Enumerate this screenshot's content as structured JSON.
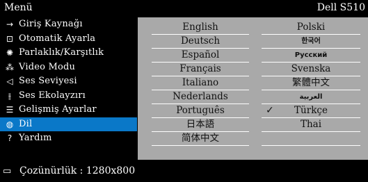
{
  "title": {
    "menu": "Menü",
    "model": "Dell S510"
  },
  "sidebar": {
    "items": [
      {
        "label": "Giriş Kaynağı",
        "icon": "→"
      },
      {
        "label": "Otomatik Ayarla",
        "icon": "⊡"
      },
      {
        "label": "Parlaklık/Karşıtlık",
        "icon": "✺"
      },
      {
        "label": "Video Modu",
        "icon": "⁂"
      },
      {
        "label": "Ses Seviyesi",
        "icon": "◁"
      },
      {
        "label": "Ses Ekolayzırı",
        "icon": "⫲"
      },
      {
        "label": "Gelişmiş Ayarlar",
        "icon": "☰"
      },
      {
        "label": "Dil",
        "icon": "◍"
      },
      {
        "label": "Yardım",
        "icon": "?"
      }
    ],
    "selected_index": 7
  },
  "languages": {
    "col1": [
      "English",
      "Deutsch",
      "Español",
      "Français",
      "Italiano",
      "Nederlands",
      "Português",
      "日本語",
      "简体中文"
    ],
    "col2": [
      "Polski",
      "한국어",
      "Русский",
      "Svenska",
      "繁體中文",
      "العربية",
      "Türkçe",
      "Thai",
      ""
    ],
    "selected": "Türkçe",
    "check_mark": "✓"
  },
  "status": {
    "icon": "▭",
    "text": "Çozünürlük : 1280x800"
  },
  "colors": {
    "selection": "#0a78c8",
    "panel": "#a9a9a9"
  }
}
